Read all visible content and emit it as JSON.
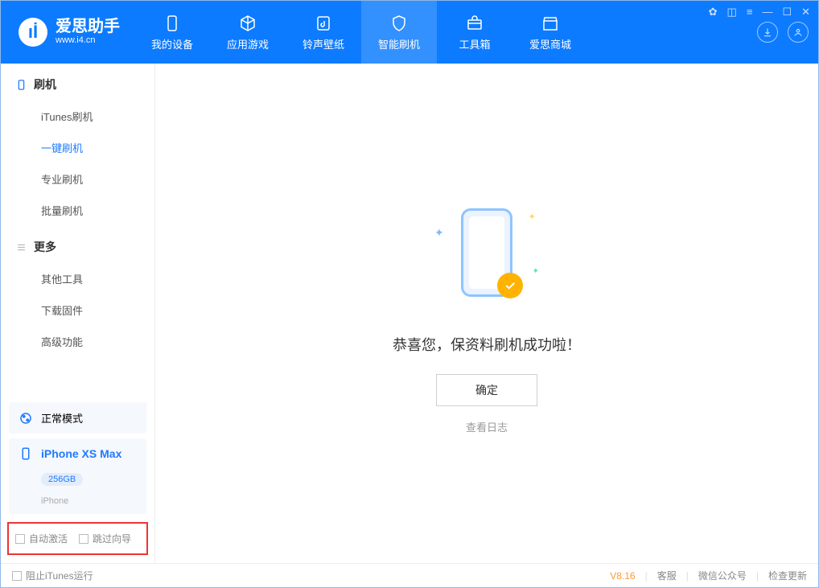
{
  "app": {
    "title": "爱思助手",
    "subtitle": "www.i4.cn"
  },
  "nav": {
    "tabs": [
      {
        "label": "我的设备"
      },
      {
        "label": "应用游戏"
      },
      {
        "label": "铃声壁纸"
      },
      {
        "label": "智能刷机"
      },
      {
        "label": "工具箱"
      },
      {
        "label": "爱思商城"
      }
    ]
  },
  "sidebar": {
    "section_flash": {
      "title": "刷机",
      "items": [
        "iTunes刷机",
        "一键刷机",
        "专业刷机",
        "批量刷机"
      ],
      "active_index": 1
    },
    "section_more": {
      "title": "更多",
      "items": [
        "其他工具",
        "下载固件",
        "高级功能"
      ]
    },
    "mode_card": {
      "label": "正常模式"
    },
    "device_card": {
      "name": "iPhone XS Max",
      "capacity": "256GB",
      "type": "iPhone"
    },
    "options": {
      "auto_activate": "自动激活",
      "skip_guide": "跳过向导"
    }
  },
  "main": {
    "success_message": "恭喜您，保资料刷机成功啦！",
    "ok_button": "确定",
    "log_link": "查看日志"
  },
  "footer": {
    "block_itunes": "阻止iTunes运行",
    "version": "V8.16",
    "links": [
      "客服",
      "微信公众号",
      "检查更新"
    ]
  }
}
